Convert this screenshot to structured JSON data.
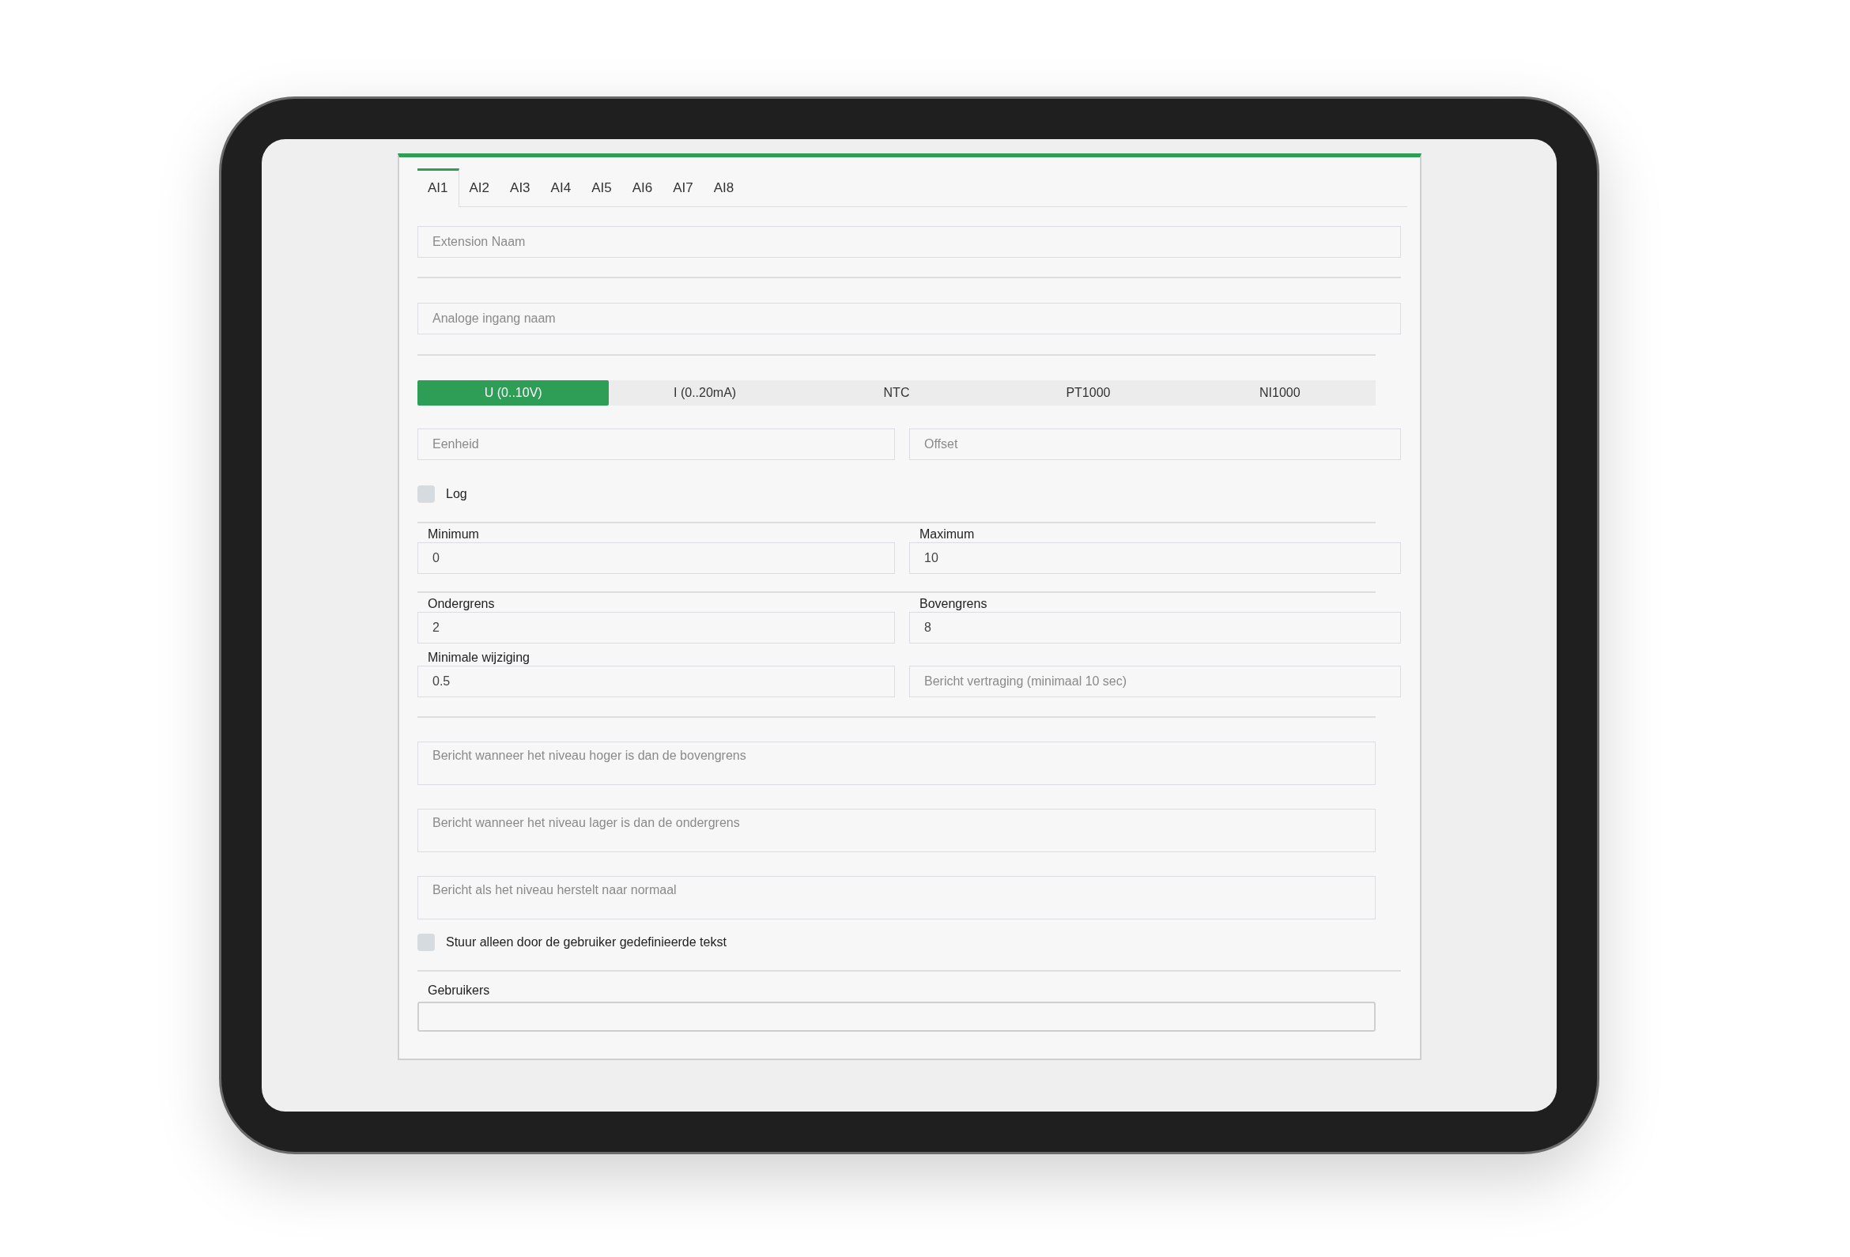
{
  "tabs": [
    {
      "label": "AI1",
      "selected": true
    },
    {
      "label": "AI2",
      "selected": false
    },
    {
      "label": "AI3",
      "selected": false
    },
    {
      "label": "AI4",
      "selected": false
    },
    {
      "label": "AI5",
      "selected": false
    },
    {
      "label": "AI6",
      "selected": false
    },
    {
      "label": "AI7",
      "selected": false
    },
    {
      "label": "AI8",
      "selected": false
    }
  ],
  "extension_name": {
    "placeholder": "Extension Naam"
  },
  "input_name": {
    "placeholder": "Analoge ingang naam"
  },
  "input_types": [
    {
      "label": "U (0..10V)",
      "selected": true
    },
    {
      "label": "I (0..20mA)",
      "selected": false
    },
    {
      "label": "NTC",
      "selected": false
    },
    {
      "label": "PT1000",
      "selected": false
    },
    {
      "label": "NI1000",
      "selected": false
    }
  ],
  "unit": {
    "placeholder": "Eenheid"
  },
  "offset": {
    "placeholder": "Offset"
  },
  "log": {
    "label": "Log",
    "checked": false
  },
  "minimum": {
    "label": "Minimum",
    "value": "0"
  },
  "maximum": {
    "label": "Maximum",
    "value": "10"
  },
  "lower_limit": {
    "label": "Ondergrens",
    "value": "2"
  },
  "upper_limit": {
    "label": "Bovengrens",
    "value": "8"
  },
  "min_change": {
    "label": "Minimale wijziging",
    "value": "0.5"
  },
  "message_delay": {
    "placeholder": "Bericht vertraging (minimaal 10 sec)"
  },
  "messages": [
    {
      "placeholder": "Bericht wanneer het niveau hoger is dan de bovengrens"
    },
    {
      "placeholder": "Bericht wanneer het niveau lager is dan de ondergrens"
    },
    {
      "placeholder": "Bericht als het niveau herstelt naar normaal"
    }
  ],
  "custom_text_only": {
    "label": "Stuur alleen door de gebruiker gedefinieerde tekst",
    "checked": false
  },
  "users": {
    "label": "Gebruikers"
  }
}
